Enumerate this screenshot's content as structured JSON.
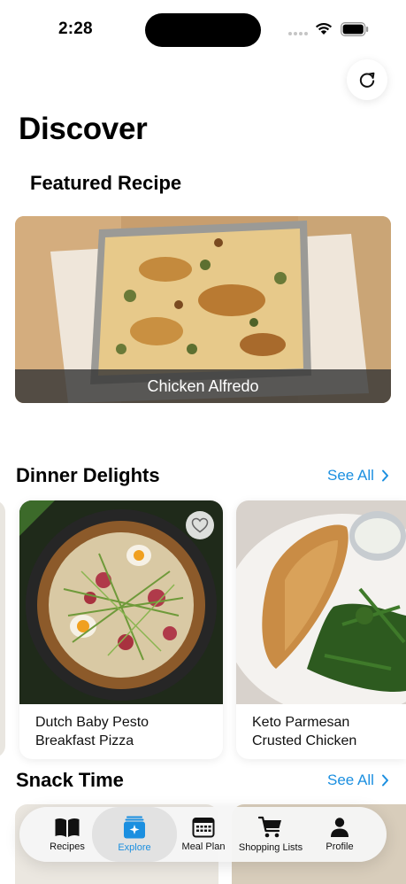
{
  "status_bar": {
    "time": "2:28"
  },
  "header": {
    "title": "Discover",
    "refresh_icon": "arrow-clockwise-icon"
  },
  "featured": {
    "heading": "Featured Recipe",
    "recipe_name": "Chicken Alfredo"
  },
  "sections": [
    {
      "title": "Dinner Delights",
      "see_all": "See All",
      "cards": [
        {
          "name_line1": "Dutch Baby Pesto",
          "name_line2": "Breakfast Pizza",
          "favorited": false
        },
        {
          "name_line1": "Keto Parmesan",
          "name_line2": "Crusted Chicken",
          "favorited": false
        }
      ]
    },
    {
      "title": "Snack Time",
      "see_all": "See All"
    }
  ],
  "tab_bar": {
    "active": "Explore",
    "items": [
      {
        "label": "Recipes",
        "icon": "book-icon"
      },
      {
        "label": "Explore",
        "icon": "explore-sparkle-icon"
      },
      {
        "label": "Meal Plan",
        "icon": "calendar-icon"
      },
      {
        "label": "Shopping Lists",
        "icon": "cart-icon"
      },
      {
        "label": "Profile",
        "icon": "person-icon"
      }
    ]
  },
  "colors": {
    "accent": "#1b8fe0",
    "text": "#000000",
    "caption_overlay": "#373737"
  }
}
